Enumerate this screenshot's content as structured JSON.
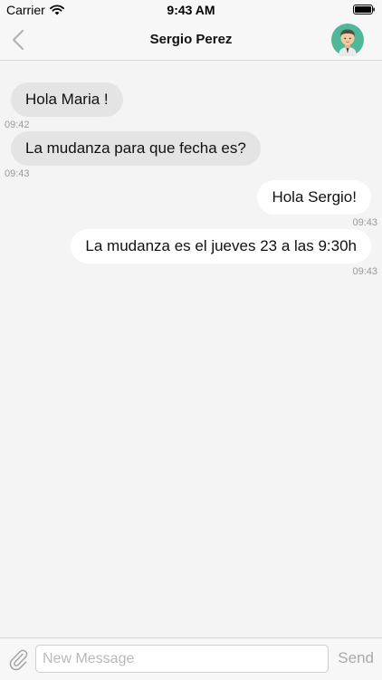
{
  "status_bar": {
    "carrier": "Carrier",
    "time": "9:43 AM"
  },
  "header": {
    "title": "Sergio Perez",
    "back_icon": "chevron-left-icon",
    "avatar_icon": "user-avatar"
  },
  "messages": [
    {
      "direction": "incoming",
      "text": "Hola Maria !",
      "time": "09:42"
    },
    {
      "direction": "incoming",
      "text": "La mudanza para que fecha es?",
      "time": "09:43"
    },
    {
      "direction": "outgoing",
      "text": "Hola Sergio!",
      "time": "09:43"
    },
    {
      "direction": "outgoing",
      "text": "La mudanza es el jueves 23 a las 9:30h",
      "time": "09:43"
    }
  ],
  "composer": {
    "placeholder": "New Message",
    "value": "",
    "send_label": "Send",
    "attach_icon": "paperclip-icon"
  },
  "colors": {
    "background": "#f4f4f4",
    "incoming_bubble": "#e4e4e4",
    "outgoing_bubble": "#ffffff",
    "avatar_circle": "#4fb89a"
  }
}
